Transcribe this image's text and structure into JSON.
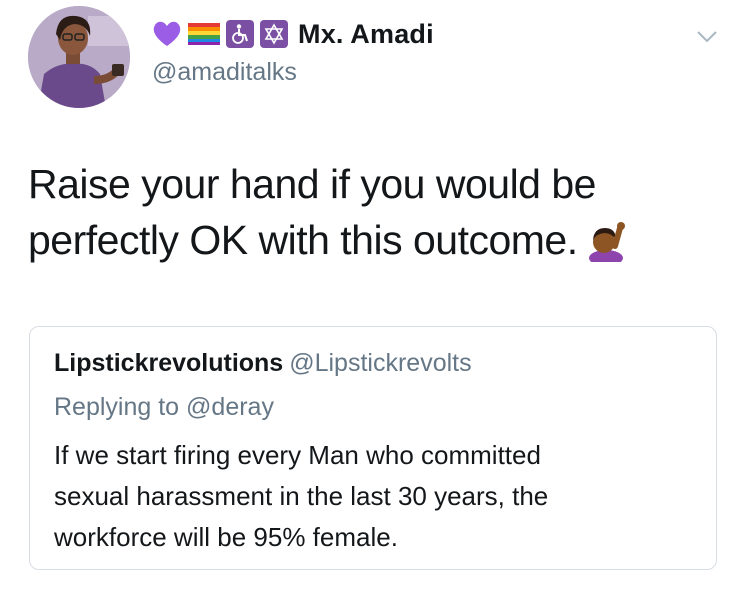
{
  "author": {
    "display_name": "Mx. Amadi",
    "handle": "@amaditalks",
    "name_emojis": [
      "purple-heart",
      "rainbow-flag",
      "wheelchair-symbol",
      "star-of-david"
    ]
  },
  "tweet": {
    "text_lines": [
      "Raise your hand if you would be",
      "perfectly OK with this outcome."
    ],
    "trailing_emoji": "person-raising-hand"
  },
  "quoted_tweet": {
    "display_name": "Lipstickrevolutions",
    "handle": "@Lipstickrevolts",
    "reply_prefix": "Replying to",
    "reply_handle": "@deray",
    "text_lines": [
      "If we start firing every Man who committed",
      "sexual harassment in the last 30 years, the",
      "workforce will be 95% female."
    ]
  },
  "colors": {
    "primary_text": "#14171a",
    "secondary_text": "#657786",
    "border": "#d8dde2",
    "emoji_purple": "#9b5de5",
    "emoji_box_purple": "#7b4fa3"
  }
}
